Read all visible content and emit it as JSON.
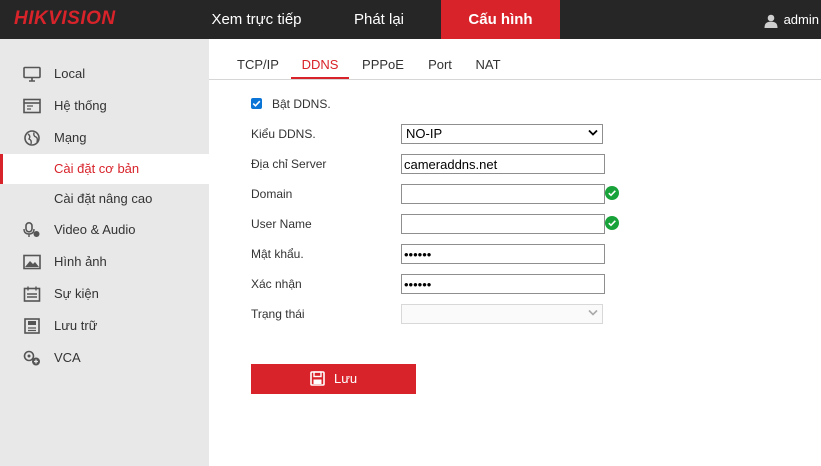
{
  "header": {
    "logo_hik": "HIK",
    "logo_vision": "VISION",
    "nav": [
      "Xem trực tiếp",
      "Phát lại",
      "Cấu hình"
    ],
    "active_nav": "Cấu hình",
    "user": "admin"
  },
  "sidebar": {
    "items": [
      {
        "label": "Local",
        "icon": "monitor-icon"
      },
      {
        "label": "Hệ thống",
        "icon": "window-icon"
      },
      {
        "label": "Mạng",
        "icon": "globe-icon"
      },
      {
        "label": "Cài đặt cơ bản",
        "sub": true,
        "active": true
      },
      {
        "label": "Cài đặt nâng cao",
        "sub": true
      },
      {
        "label": "Video & Audio",
        "icon": "microphone-icon"
      },
      {
        "label": "Hình ảnh",
        "icon": "image-icon"
      },
      {
        "label": "Sự kiện",
        "icon": "calendar-icon"
      },
      {
        "label": "Lưu trữ",
        "icon": "storage-icon"
      },
      {
        "label": "VCA",
        "icon": "vca-icon"
      }
    ]
  },
  "tabs": [
    "TCP/IP",
    "DDNS",
    "PPPoE",
    "Port",
    "NAT"
  ],
  "active_tab": "DDNS",
  "form": {
    "enable_label": "Bật DDNS.",
    "enable_checked": true,
    "type_label": "Kiểu DDNS.",
    "type_value": "NO-IP",
    "server_label": "Địa chỉ Server",
    "server_value": "cameraddns.net",
    "domain_label": "Domain",
    "domain_value": "",
    "username_label": "User Name",
    "username_value": "",
    "password_label": "Mật khẩu.",
    "password_value": "••••••",
    "confirm_label": "Xác nhận",
    "confirm_value": "••••••",
    "status_label": "Trạng thái",
    "status_value": ""
  },
  "save_label": "Lưu",
  "colors": {
    "accent": "#d8232a",
    "topbar": "#262626",
    "sidebar": "#e8e8e8",
    "ok": "#18a33a"
  }
}
